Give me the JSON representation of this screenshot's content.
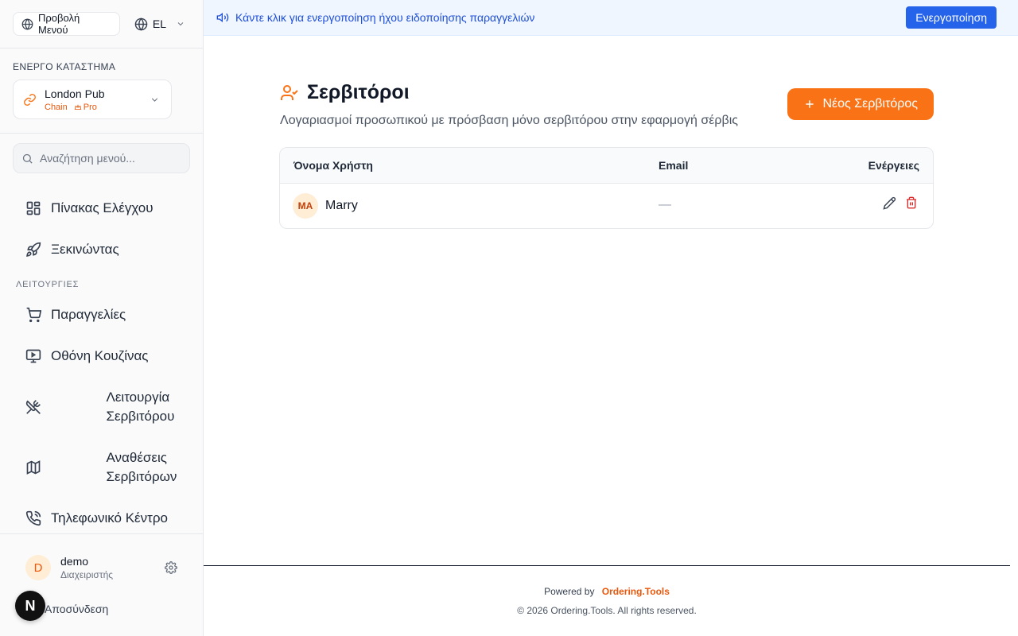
{
  "top_bar": {
    "menu_view_label": "Προβολή Μενού",
    "language": "EL"
  },
  "store": {
    "caption": "ΕΝΕΡΓΟ ΚΑΤΑΣΤΗΜΑ",
    "name": "London Pub",
    "type_tag": "Chain",
    "plan_tag": "Pro"
  },
  "search": {
    "placeholder": "Αναζήτηση μενού..."
  },
  "nav": {
    "dashboard": "Πίνακας Ελέγχου",
    "getting_started": "Ξεκινώντας",
    "section_caption": "ΛΕΙΤΟΥΡΓΙΕΣ",
    "orders": "Παραγγελίες",
    "kitchen_screen": "Οθόνη Κουζίνας",
    "waiter_mode": "Λειτουργία Σερβιτόρου",
    "waiter_assignments": "Αναθέσεις Σερβιτόρων",
    "call_center": "Τηλεφωνικό Κέντρο"
  },
  "user": {
    "initial": "D",
    "name": "demo",
    "role": "Διαχειριστής",
    "logout_label": "Αποσύνδεση",
    "badge": "N"
  },
  "notice": {
    "text": "Κάντε κλικ για ενεργοποίηση ήχου ειδοποίησης παραγγελιών",
    "button_label": "Ενεργοποίηση"
  },
  "page": {
    "title": "Σερβιτόροι",
    "subtitle": "Λογαριασμοί προσωπικού με πρόσβαση μόνο σερβιτόρου στην εφαρμογή σέρβις",
    "new_button_label": "Νέος Σερβιτόρος"
  },
  "table": {
    "columns": {
      "name": "Όνομα Χρήστη",
      "email": "Email",
      "actions": "Ενέργειες"
    },
    "rows": [
      {
        "initials": "MA",
        "name": "Marry",
        "email": "—"
      }
    ]
  },
  "footer": {
    "powered_prefix": "Powered by",
    "brand": "Ordering.Tools",
    "copyright": "© 2026 Ordering.Tools. All rights reserved."
  },
  "colors": {
    "accent": "#f97316",
    "primary_blue": "#2563eb",
    "danger": "#dc2626"
  }
}
